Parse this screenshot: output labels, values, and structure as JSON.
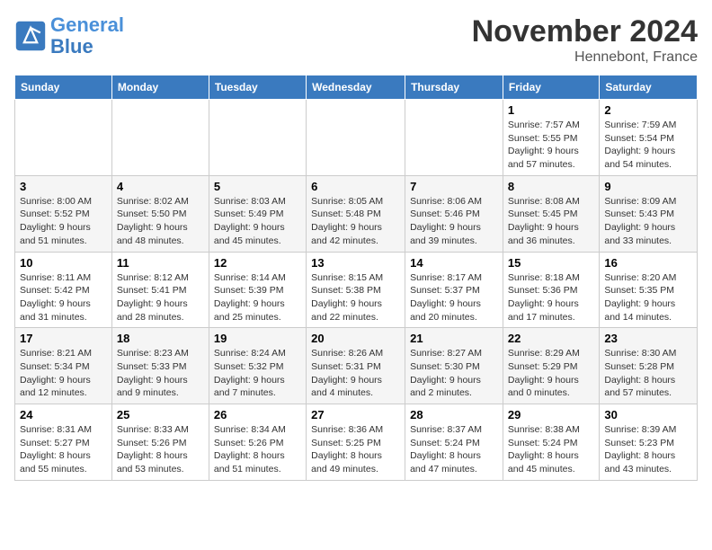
{
  "header": {
    "logo_line1": "General",
    "logo_line2": "Blue",
    "month": "November 2024",
    "location": "Hennebont, France"
  },
  "weekdays": [
    "Sunday",
    "Monday",
    "Tuesday",
    "Wednesday",
    "Thursday",
    "Friday",
    "Saturday"
  ],
  "weeks": [
    [
      {
        "day": "",
        "info": ""
      },
      {
        "day": "",
        "info": ""
      },
      {
        "day": "",
        "info": ""
      },
      {
        "day": "",
        "info": ""
      },
      {
        "day": "",
        "info": ""
      },
      {
        "day": "1",
        "info": "Sunrise: 7:57 AM\nSunset: 5:55 PM\nDaylight: 9 hours and 57 minutes."
      },
      {
        "day": "2",
        "info": "Sunrise: 7:59 AM\nSunset: 5:54 PM\nDaylight: 9 hours and 54 minutes."
      }
    ],
    [
      {
        "day": "3",
        "info": "Sunrise: 8:00 AM\nSunset: 5:52 PM\nDaylight: 9 hours and 51 minutes."
      },
      {
        "day": "4",
        "info": "Sunrise: 8:02 AM\nSunset: 5:50 PM\nDaylight: 9 hours and 48 minutes."
      },
      {
        "day": "5",
        "info": "Sunrise: 8:03 AM\nSunset: 5:49 PM\nDaylight: 9 hours and 45 minutes."
      },
      {
        "day": "6",
        "info": "Sunrise: 8:05 AM\nSunset: 5:48 PM\nDaylight: 9 hours and 42 minutes."
      },
      {
        "day": "7",
        "info": "Sunrise: 8:06 AM\nSunset: 5:46 PM\nDaylight: 9 hours and 39 minutes."
      },
      {
        "day": "8",
        "info": "Sunrise: 8:08 AM\nSunset: 5:45 PM\nDaylight: 9 hours and 36 minutes."
      },
      {
        "day": "9",
        "info": "Sunrise: 8:09 AM\nSunset: 5:43 PM\nDaylight: 9 hours and 33 minutes."
      }
    ],
    [
      {
        "day": "10",
        "info": "Sunrise: 8:11 AM\nSunset: 5:42 PM\nDaylight: 9 hours and 31 minutes."
      },
      {
        "day": "11",
        "info": "Sunrise: 8:12 AM\nSunset: 5:41 PM\nDaylight: 9 hours and 28 minutes."
      },
      {
        "day": "12",
        "info": "Sunrise: 8:14 AM\nSunset: 5:39 PM\nDaylight: 9 hours and 25 minutes."
      },
      {
        "day": "13",
        "info": "Sunrise: 8:15 AM\nSunset: 5:38 PM\nDaylight: 9 hours and 22 minutes."
      },
      {
        "day": "14",
        "info": "Sunrise: 8:17 AM\nSunset: 5:37 PM\nDaylight: 9 hours and 20 minutes."
      },
      {
        "day": "15",
        "info": "Sunrise: 8:18 AM\nSunset: 5:36 PM\nDaylight: 9 hours and 17 minutes."
      },
      {
        "day": "16",
        "info": "Sunrise: 8:20 AM\nSunset: 5:35 PM\nDaylight: 9 hours and 14 minutes."
      }
    ],
    [
      {
        "day": "17",
        "info": "Sunrise: 8:21 AM\nSunset: 5:34 PM\nDaylight: 9 hours and 12 minutes."
      },
      {
        "day": "18",
        "info": "Sunrise: 8:23 AM\nSunset: 5:33 PM\nDaylight: 9 hours and 9 minutes."
      },
      {
        "day": "19",
        "info": "Sunrise: 8:24 AM\nSunset: 5:32 PM\nDaylight: 9 hours and 7 minutes."
      },
      {
        "day": "20",
        "info": "Sunrise: 8:26 AM\nSunset: 5:31 PM\nDaylight: 9 hours and 4 minutes."
      },
      {
        "day": "21",
        "info": "Sunrise: 8:27 AM\nSunset: 5:30 PM\nDaylight: 9 hours and 2 minutes."
      },
      {
        "day": "22",
        "info": "Sunrise: 8:29 AM\nSunset: 5:29 PM\nDaylight: 9 hours and 0 minutes."
      },
      {
        "day": "23",
        "info": "Sunrise: 8:30 AM\nSunset: 5:28 PM\nDaylight: 8 hours and 57 minutes."
      }
    ],
    [
      {
        "day": "24",
        "info": "Sunrise: 8:31 AM\nSunset: 5:27 PM\nDaylight: 8 hours and 55 minutes."
      },
      {
        "day": "25",
        "info": "Sunrise: 8:33 AM\nSunset: 5:26 PM\nDaylight: 8 hours and 53 minutes."
      },
      {
        "day": "26",
        "info": "Sunrise: 8:34 AM\nSunset: 5:26 PM\nDaylight: 8 hours and 51 minutes."
      },
      {
        "day": "27",
        "info": "Sunrise: 8:36 AM\nSunset: 5:25 PM\nDaylight: 8 hours and 49 minutes."
      },
      {
        "day": "28",
        "info": "Sunrise: 8:37 AM\nSunset: 5:24 PM\nDaylight: 8 hours and 47 minutes."
      },
      {
        "day": "29",
        "info": "Sunrise: 8:38 AM\nSunset: 5:24 PM\nDaylight: 8 hours and 45 minutes."
      },
      {
        "day": "30",
        "info": "Sunrise: 8:39 AM\nSunset: 5:23 PM\nDaylight: 8 hours and 43 minutes."
      }
    ]
  ]
}
